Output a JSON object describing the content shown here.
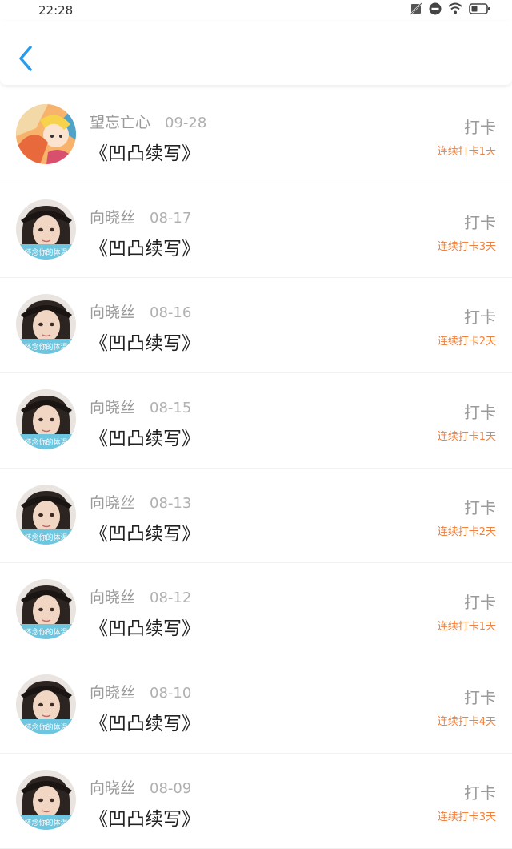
{
  "status_bar": {
    "time": "22:28",
    "icons": [
      "no-sim-icon",
      "do-not-disturb-icon",
      "wifi-icon",
      "battery-icon"
    ]
  },
  "header": {
    "back_icon": "chevron-left-icon",
    "accent_color": "#2a9bea"
  },
  "colors": {
    "streak": "#f0803c",
    "name": "#9a9a9a",
    "title": "#222222"
  },
  "entries": [
    {
      "user": "望忘亡心",
      "date": "09-28",
      "title": "《凹凸续写》",
      "action": "打卡",
      "streak": "连续打卡1天",
      "avatar": "anime-avatar"
    },
    {
      "user": "向晓丝",
      "date": "08-17",
      "title": "《凹凸续写》",
      "action": "打卡",
      "streak": "连续打卡3天",
      "avatar": "doll-avatar",
      "avatar_caption": "怀念你的体温"
    },
    {
      "user": "向晓丝",
      "date": "08-16",
      "title": "《凹凸续写》",
      "action": "打卡",
      "streak": "连续打卡2天",
      "avatar": "doll-avatar",
      "avatar_caption": "怀念你的体温"
    },
    {
      "user": "向晓丝",
      "date": "08-15",
      "title": "《凹凸续写》",
      "action": "打卡",
      "streak": "连续打卡1天",
      "avatar": "doll-avatar",
      "avatar_caption": "怀念你的体温"
    },
    {
      "user": "向晓丝",
      "date": "08-13",
      "title": "《凹凸续写》",
      "action": "打卡",
      "streak": "连续打卡2天",
      "avatar": "doll-avatar",
      "avatar_caption": "怀念你的体温"
    },
    {
      "user": "向晓丝",
      "date": "08-12",
      "title": "《凹凸续写》",
      "action": "打卡",
      "streak": "连续打卡1天",
      "avatar": "doll-avatar",
      "avatar_caption": "怀念你的体温"
    },
    {
      "user": "向晓丝",
      "date": "08-10",
      "title": "《凹凸续写》",
      "action": "打卡",
      "streak": "连续打卡4天",
      "avatar": "doll-avatar",
      "avatar_caption": "怀念你的体温"
    },
    {
      "user": "向晓丝",
      "date": "08-09",
      "title": "《凹凸续写》",
      "action": "打卡",
      "streak": "连续打卡3天",
      "avatar": "doll-avatar",
      "avatar_caption": "怀念你的体温"
    }
  ]
}
